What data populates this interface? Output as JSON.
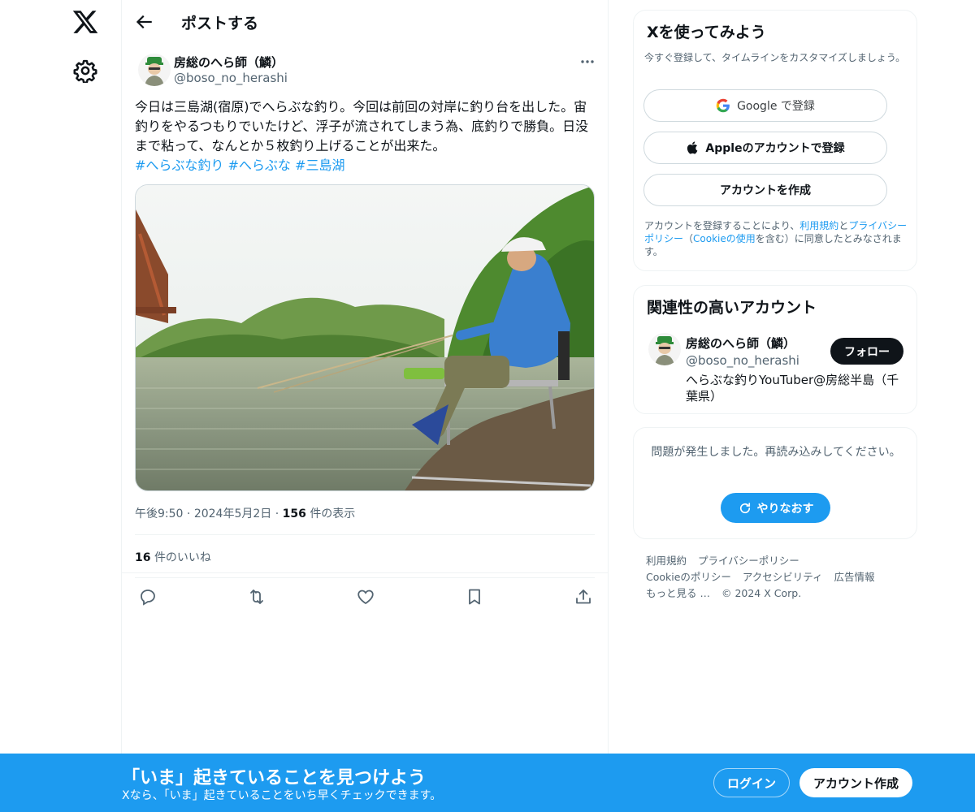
{
  "colors": {
    "accent": "#1d9bf0",
    "text": "#0f1419",
    "muted": "#536471",
    "border": "#eff3f4"
  },
  "icons": {
    "logo": "x-logo-icon",
    "settings": "gear-icon",
    "back": "arrow-left-icon",
    "more": "more-dots-icon",
    "reply": "reply-icon",
    "repost": "repost-icon",
    "like": "heart-icon",
    "bookmark": "bookmark-icon",
    "share": "share-icon",
    "google": "google-icon",
    "apple": "apple-icon",
    "retry": "refresh-icon"
  },
  "header": {
    "title": "ポストする"
  },
  "post": {
    "author_name": "房総のへら師（鱗）",
    "author_handle": "@boso_no_herashi",
    "text": "今日は三島湖(宿原)でへらぶな釣り。今回は前回の対岸に釣り台を出した。宙釣りをやるつもりでいたけど、浮子が流されてしまう為、底釣りで勝負。日没まで粘って、なんとか５枚釣り上げることが出来た。",
    "hashtags": [
      "#へらぶな釣り",
      "#へらぶな",
      "#三島湖"
    ],
    "time": "午後9:50",
    "date": "2024年5月2日",
    "views_count": "156",
    "views_label": "件の表示",
    "likes_count": "16",
    "likes_label": "件のいいね"
  },
  "signup": {
    "title": "Xを使ってみよう",
    "subtitle": "今すぐ登録して、タイムラインをカスタマイズしましょう。",
    "google_label": "Google で登録",
    "apple_label": "Appleのアカウントで登録",
    "create_label": "アカウントを作成",
    "terms_prefix": "アカウントを登録することにより、",
    "terms_link1": "利用規約",
    "terms_and": "と",
    "terms_link2": "プライバシーポリシー",
    "terms_paren_open": "（",
    "terms_link3": "Cookieの使用",
    "terms_suffix": "を含む）に同意したとみなされます。"
  },
  "relevant": {
    "title": "関連性の高いアカウント",
    "name": "房総のへら師（鱗）",
    "handle": "@boso_no_herashi",
    "bio": "へらぶな釣りYouTuber@房総半島（千葉県）",
    "follow_label": "フォロー"
  },
  "error": {
    "message": "問題が発生しました。再読み込みしてください。",
    "retry_label": "やりなおす"
  },
  "footer": {
    "links": [
      "利用規約",
      "プライバシーポリシー",
      "Cookieのポリシー",
      "アクセシビリティ",
      "広告情報",
      "もっと見る …",
      "© 2024 X Corp."
    ]
  },
  "bottom_bar": {
    "title": "「いま」起きていることを見つけよう",
    "subtitle": "Xなら、「いま」起きていることをいち早くチェックできます。",
    "login_label": "ログイン",
    "signup_label": "アカウント作成"
  }
}
